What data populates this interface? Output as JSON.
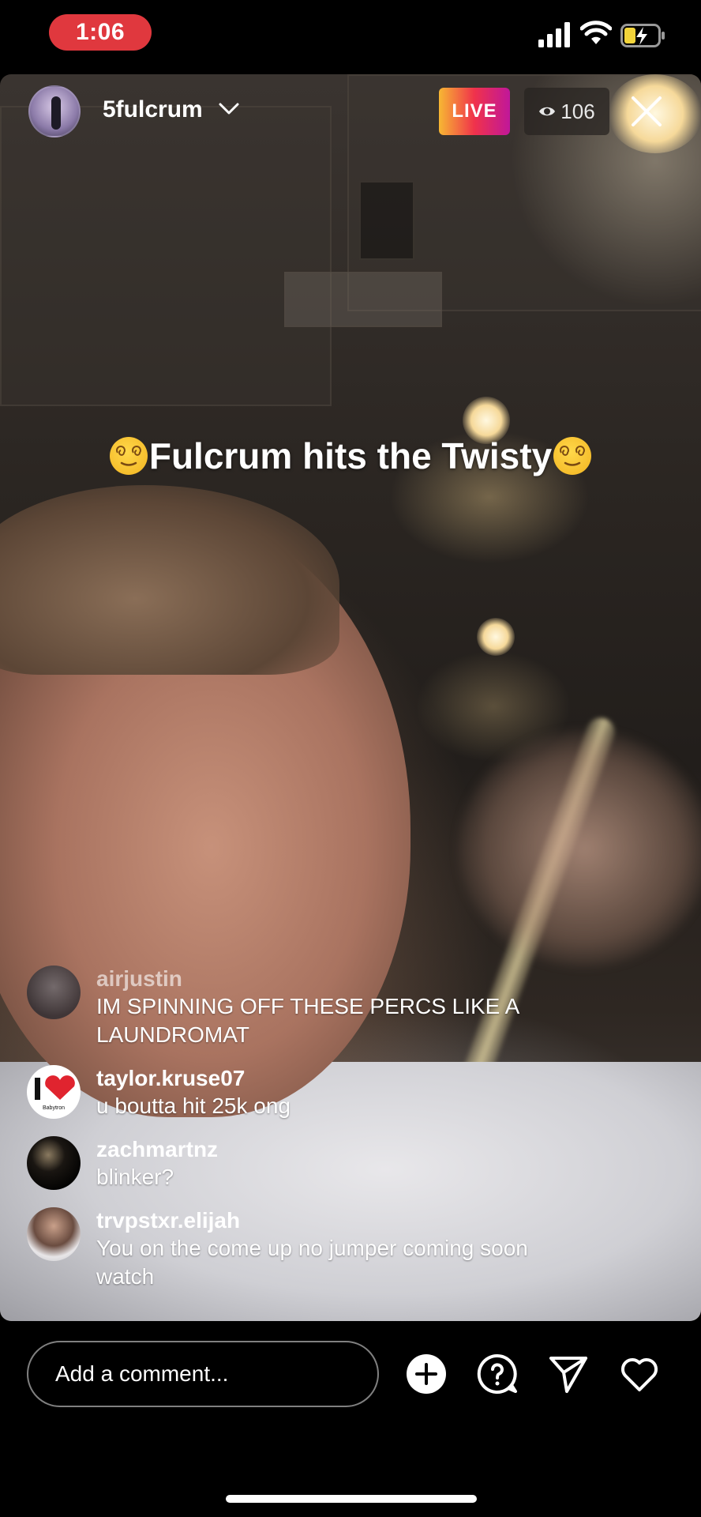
{
  "status_bar": {
    "time": "1:06"
  },
  "live": {
    "host_username": "5fulcrum",
    "live_label": "LIVE",
    "viewer_count": "106",
    "title": "Fulcrum hits the Twisty"
  },
  "comments": [
    {
      "username": "airjustin",
      "text": "IM SPINNING OFF THESE PERCS LIKE A LAUNDROMAT"
    },
    {
      "username": "taylor.kruse07",
      "text": "u boutta hit 25k ong"
    },
    {
      "username": "zachmartnz",
      "text": "blinker?"
    },
    {
      "username": "trvpstxr.elijah",
      "text": "You on the come up no jumper coming soon watch"
    }
  ],
  "bottom_bar": {
    "comment_placeholder": "Add a comment..."
  },
  "icons": [
    "chevron-down-icon",
    "eye-icon",
    "close-icon",
    "plus-circle-icon",
    "question-icon",
    "send-icon",
    "heart-icon"
  ],
  "colors": {
    "time_pill": "#e0383e",
    "live_gradient_start": "#f7b733",
    "live_gradient_end": "#c0179a",
    "heart_logo": "#e0242f"
  },
  "avatar_badge_text": {
    "taylor_kruse07": "Babytron"
  }
}
